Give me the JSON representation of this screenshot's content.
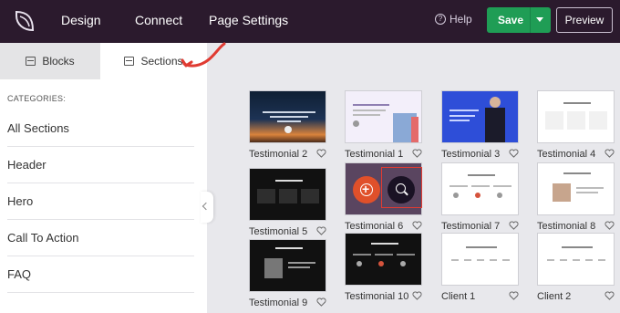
{
  "topbar": {
    "nav": [
      "Design",
      "Connect",
      "Page Settings"
    ],
    "help_label": "Help",
    "help_glyph": "?",
    "save_label": "Save",
    "preview_label": "Preview"
  },
  "sidebar": {
    "tabs": [
      {
        "label": "Blocks",
        "icon": "blocks-icon",
        "active": false
      },
      {
        "label": "Sections",
        "icon": "sections-icon",
        "active": true
      }
    ],
    "categories_title": "CATEGORIES:",
    "categories": [
      "All Sections",
      "Header",
      "Hero",
      "Call To Action",
      "FAQ"
    ]
  },
  "grid": {
    "cards": [
      {
        "label": "Testimonial 2",
        "style": "sunset"
      },
      {
        "label": "Testimonial 1",
        "style": "lavender"
      },
      {
        "label": "Testimonial 3",
        "style": "blue"
      },
      {
        "label": "Testimonial 4",
        "style": "white"
      },
      {
        "label": "Testimonial 5",
        "style": "dark"
      },
      {
        "label": "Testimonial 6",
        "style": "hover"
      },
      {
        "label": "Testimonial 7",
        "style": "white"
      },
      {
        "label": "Testimonial 8",
        "style": "white-photo"
      },
      {
        "label": "Testimonial 9",
        "style": "dark-photo"
      },
      {
        "label": "Testimonial 10",
        "style": "dark"
      },
      {
        "label": "Client 1",
        "style": "clients"
      },
      {
        "label": "Client 2",
        "style": "clients"
      }
    ]
  },
  "colors": {
    "topbar": "#2b1a2d",
    "save": "#1f9d55",
    "accent_red": "#e03b32",
    "add_orange": "#e0502a"
  }
}
